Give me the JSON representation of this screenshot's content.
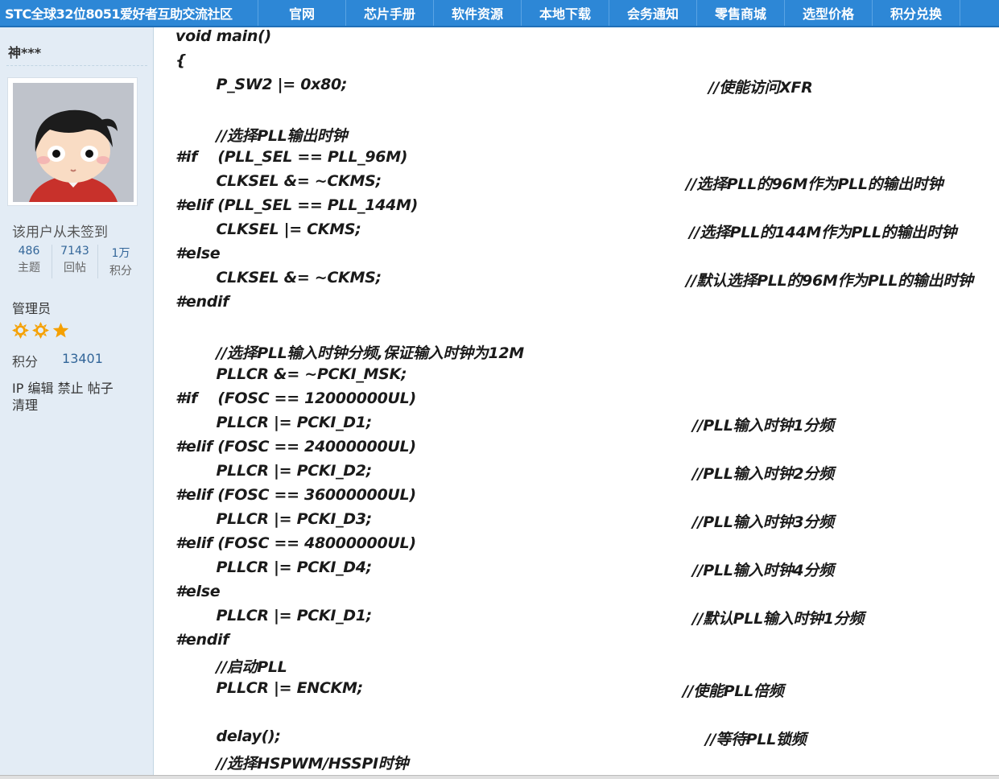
{
  "header": {
    "site_title": "STC全球32位8051爱好者互助交流社区",
    "nav": [
      "官网",
      "芯片手册",
      "软件资源",
      "本地下载",
      "会务通知",
      "零售商城",
      "选型价格",
      "积分兑换"
    ]
  },
  "user": {
    "name": "神***",
    "signin_status": "该用户从未签到",
    "stats": [
      {
        "value": "486",
        "label": "主题"
      },
      {
        "value": "7143",
        "label": "回帖"
      },
      {
        "value": "1万",
        "label": "积分"
      }
    ],
    "role": "管理员",
    "stars": [
      "sun-icon",
      "sun-icon",
      "star-icon"
    ],
    "star_color": "#f5a000",
    "points_label": "积分",
    "points_value": "13401",
    "actions": [
      "IP",
      "编辑",
      "禁止",
      "帖子",
      "清理"
    ]
  },
  "code": {
    "lines": [
      {
        "code": "void main()",
        "comment": ""
      },
      {
        "code": "{",
        "comment": ""
      },
      {
        "code": "        P_SW2 |= 0x80;",
        "comment": "//使能访问XFR"
      },
      {
        "code": "",
        "comment": ""
      },
      {
        "code": "        //选择PLL输出时钟",
        "comment": ""
      },
      {
        "code": "#if    (PLL_SEL == PLL_96M)",
        "comment": ""
      },
      {
        "code": "        CLKSEL &= ~CKMS;",
        "comment": "//选择PLL的96M作为PLL的输出时钟"
      },
      {
        "code": "#elif (PLL_SEL == PLL_144M)",
        "comment": ""
      },
      {
        "code": "        CLKSEL |= CKMS;",
        "comment": "//选择PLL的144M作为PLL的输出时钟"
      },
      {
        "code": "#else",
        "comment": ""
      },
      {
        "code": "        CLKSEL &= ~CKMS;",
        "comment": "//默认选择PLL的96M作为PLL的输出时钟"
      },
      {
        "code": "#endif",
        "comment": ""
      },
      {
        "code": "",
        "comment": ""
      },
      {
        "code": "        //选择PLL输入时钟分频,保证输入时钟为12M",
        "comment": ""
      },
      {
        "code": "        PLLCR &= ~PCKI_MSK;",
        "comment": ""
      },
      {
        "code": "#if    (FOSC == 12000000UL)",
        "comment": ""
      },
      {
        "code": "        PLLCR |= PCKI_D1;",
        "comment": "//PLL输入时钟1分频"
      },
      {
        "code": "#elif (FOSC == 24000000UL)",
        "comment": ""
      },
      {
        "code": "        PLLCR |= PCKI_D2;",
        "comment": "//PLL输入时钟2分频"
      },
      {
        "code": "#elif (FOSC == 36000000UL)",
        "comment": ""
      },
      {
        "code": "        PLLCR |= PCKI_D3;",
        "comment": "//PLL输入时钟3分频"
      },
      {
        "code": "#elif (FOSC == 48000000UL)",
        "comment": ""
      },
      {
        "code": "        PLLCR |= PCKI_D4;",
        "comment": "//PLL输入时钟4分频"
      },
      {
        "code": "#else",
        "comment": ""
      },
      {
        "code": "        PLLCR |= PCKI_D1;",
        "comment": "//默认PLL输入时钟1分频"
      },
      {
        "code": "#endif",
        "comment": ""
      },
      {
        "code": "        //启动PLL",
        "comment": ""
      },
      {
        "code": "        PLLCR |= ENCKM;",
        "comment": "//使能PLL倍频"
      },
      {
        "code": "",
        "comment": ""
      },
      {
        "code": "        delay();",
        "comment": "//等待PLL锁频"
      },
      {
        "code": "        //选择HSPWM/HSSPI时钟",
        "comment": ""
      }
    ]
  }
}
